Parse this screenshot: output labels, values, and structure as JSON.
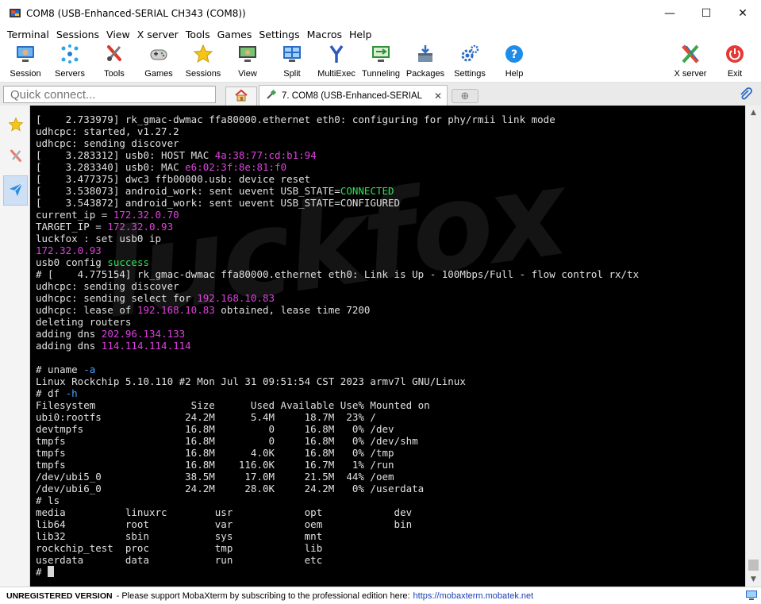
{
  "window": {
    "title": "COM8  (USB-Enhanced-SERIAL CH343 (COM8))",
    "minimize_glyph": "—",
    "maximize_glyph": "☐",
    "close_glyph": "✕"
  },
  "menu": [
    "Terminal",
    "Sessions",
    "View",
    "X server",
    "Tools",
    "Games",
    "Settings",
    "Macros",
    "Help"
  ],
  "toolbar": {
    "session": "Session",
    "servers": "Servers",
    "tools": "Tools",
    "games": "Games",
    "sessions": "Sessions",
    "view": "View",
    "split": "Split",
    "multiexec": "MultiExec",
    "tunneling": "Tunneling",
    "packages": "Packages",
    "settings": "Settings",
    "help": "Help",
    "xserver": "X server",
    "exit": "Exit"
  },
  "tabs": {
    "quick_connect_placeholder": "Quick connect...",
    "active_tab_label": "7. COM8  (USB-Enhanced-SERIAL",
    "close_glyph": "✕",
    "new_tab_glyph": "⊕"
  },
  "terminal": {
    "watermark": "luckfox",
    "lines": [
      [
        {
          "t": "[    2.733979] rk_gmac-dwmac ffa80000.ethernet eth0: configuring for phy/rmii link mode"
        }
      ],
      [
        {
          "t": "udhcpc: started, v1.27.2"
        }
      ],
      [
        {
          "t": "udhcpc: sending discover"
        }
      ],
      [
        {
          "t": "[    3.283312] usb0: HOST MAC "
        },
        {
          "t": "4a:38:77:cd:b1:94",
          "c": "mag"
        }
      ],
      [
        {
          "t": "[    3.283340] usb0: MAC "
        },
        {
          "t": "e6:02:3f:8e:81:f0",
          "c": "mag"
        }
      ],
      [
        {
          "t": "[    3.477375] dwc3 ffb00000.usb: device reset"
        }
      ],
      [
        {
          "t": "[    3.538073] android_work: sent uevent USB_STATE="
        },
        {
          "t": "CONNECTED",
          "c": "grn"
        }
      ],
      [
        {
          "t": "[    3.543872] android_work: sent uevent USB_STATE=CONFIGURED"
        }
      ],
      [
        {
          "t": "current_ip = "
        },
        {
          "t": "172.32.0.70",
          "c": "mag"
        }
      ],
      [
        {
          "t": "TARGET_IP = "
        },
        {
          "t": "172.32.0.93",
          "c": "mag"
        }
      ],
      [
        {
          "t": "luckfox : set usb0 ip"
        }
      ],
      [
        {
          "t": "172.32.0.93",
          "c": "mag"
        }
      ],
      [
        {
          "t": "usb0 config "
        },
        {
          "t": "success",
          "c": "grn"
        }
      ],
      [
        {
          "t": "# [    4.775154] rk_gmac-dwmac ffa80000.ethernet eth0: Link is Up - 100Mbps/Full - flow control rx/tx"
        }
      ],
      [
        {
          "t": "udhcpc: sending discover"
        }
      ],
      [
        {
          "t": "udhcpc: sending select for "
        },
        {
          "t": "192.168.10.83",
          "c": "mag"
        }
      ],
      [
        {
          "t": "udhcpc: lease of "
        },
        {
          "t": "192.168.10.83",
          "c": "mag"
        },
        {
          "t": " obtained, lease time 7200"
        }
      ],
      [
        {
          "t": "deleting routers"
        }
      ],
      [
        {
          "t": "adding dns "
        },
        {
          "t": "202.96.134.133",
          "c": "mag"
        }
      ],
      [
        {
          "t": "adding dns "
        },
        {
          "t": "114.114.114.114",
          "c": "mag"
        }
      ],
      [
        {
          "t": ""
        }
      ],
      [
        {
          "t": "# uname "
        },
        {
          "t": "-a",
          "c": "cyan"
        }
      ],
      [
        {
          "t": "Linux Rockchip 5.10.110 #2 Mon Jul 31 09:51:54 CST 2023 armv7l GNU/Linux"
        }
      ],
      [
        {
          "t": "# df "
        },
        {
          "t": "-h",
          "c": "cyan"
        }
      ],
      [
        {
          "t": "Filesystem                Size      Used Available Use% Mounted on"
        }
      ],
      [
        {
          "t": "ubi0:rootfs              24.2M      5.4M     18.7M  23% /"
        }
      ],
      [
        {
          "t": "devtmpfs                 16.8M         0     16.8M   0% /dev"
        }
      ],
      [
        {
          "t": "tmpfs                    16.8M         0     16.8M   0% /dev/shm"
        }
      ],
      [
        {
          "t": "tmpfs                    16.8M      4.0K     16.8M   0% /tmp"
        }
      ],
      [
        {
          "t": "tmpfs                    16.8M    116.0K     16.7M   1% /run"
        }
      ],
      [
        {
          "t": "/dev/ubi5_0              38.5M     17.0M     21.5M  44% /oem"
        }
      ],
      [
        {
          "t": "/dev/ubi6_0              24.2M     28.0K     24.2M   0% /userdata"
        }
      ],
      [
        {
          "t": "# ls"
        }
      ],
      [
        {
          "t": "media          linuxrc        usr            opt            dev"
        }
      ],
      [
        {
          "t": "lib64          root           var            oem            bin"
        }
      ],
      [
        {
          "t": "lib32          sbin           sys            mnt"
        }
      ],
      [
        {
          "t": "rockchip_test  proc           tmp            lib"
        }
      ],
      [
        {
          "t": "userdata       data           run            etc"
        }
      ],
      [
        {
          "t": "# "
        },
        {
          "cursor": true
        }
      ]
    ]
  },
  "status": {
    "unregistered": "UNREGISTERED VERSION",
    "message": "-  Please support MobaXterm by subscribing to the professional edition here:",
    "link": "https://mobaxterm.mobatek.net"
  },
  "colors": {
    "magenta": "#e040e0",
    "green": "#33e05a",
    "cyan": "#4aa0ff"
  }
}
